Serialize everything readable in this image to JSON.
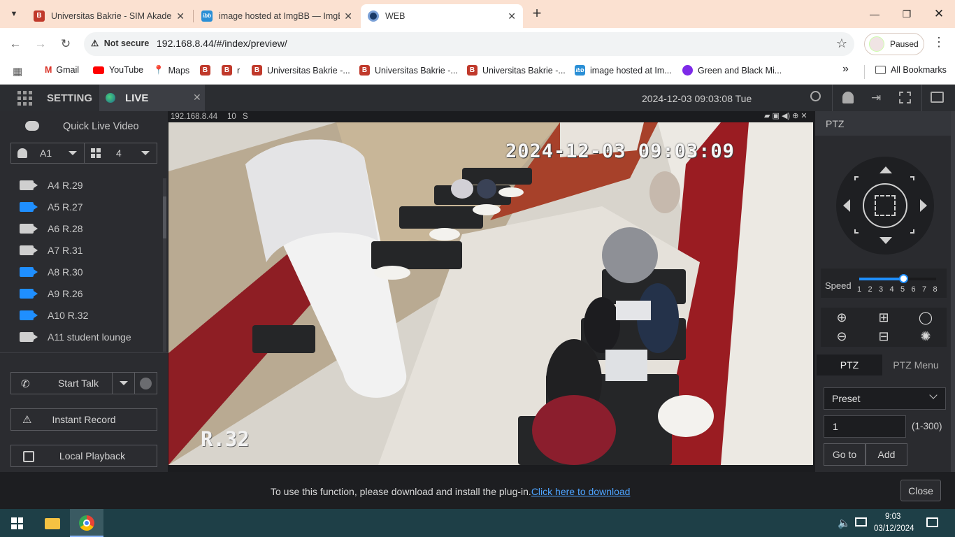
{
  "browser": {
    "tabs": [
      {
        "title": "Universitas Bakrie - SIM Akaden",
        "icon": "ub"
      },
      {
        "title": "image hosted at ImgBB — ImgB",
        "icon": "ibb"
      },
      {
        "title": "WEB",
        "icon": "web"
      }
    ],
    "new_tab": "+",
    "security_label": "Not secure",
    "url": "192.168.8.44/#/index/preview/",
    "profile_status": "Paused",
    "bookmarks": [
      {
        "label": "Gmail",
        "icon": "gmail"
      },
      {
        "label": "YouTube",
        "icon": "youtube"
      },
      {
        "label": "Maps",
        "icon": "maps"
      },
      {
        "label": "",
        "icon": "ub"
      },
      {
        "label": "r",
        "icon": "ub"
      },
      {
        "label": "Universitas Bakrie -...",
        "icon": "ub"
      },
      {
        "label": "Universitas Bakrie -...",
        "icon": "ub"
      },
      {
        "label": "Universitas Bakrie -...",
        "icon": "ub"
      },
      {
        "label": "image hosted at Im...",
        "icon": "ibb"
      },
      {
        "label": "Green and Black Mi...",
        "icon": "canva"
      }
    ],
    "more_bookmarks": "»",
    "all_bookmarks": "All Bookmarks"
  },
  "app": {
    "setting_tab": "SETTING",
    "live_tab": "LIVE",
    "datetime": "2024-12-03 09:03:08 Tue",
    "left": {
      "quick_live": "Quick Live Video",
      "channel_select": "A1",
      "split_select": "4",
      "cameras": [
        {
          "label": "A4 R.29",
          "status": "offline"
        },
        {
          "label": "A5 R.27",
          "status": "online"
        },
        {
          "label": "A6 R.28",
          "status": "offline"
        },
        {
          "label": "A7 R.31",
          "status": "offline"
        },
        {
          "label": "A8 R.30",
          "status": "online"
        },
        {
          "label": "A9 R.26",
          "status": "online"
        },
        {
          "label": "A10 R.32",
          "status": "online"
        },
        {
          "label": "A11 student lounge",
          "status": "offline"
        }
      ],
      "start_talk": "Start Talk",
      "instant_record": "Instant Record",
      "local_playback": "Local Playback"
    },
    "video": {
      "info_ip": "192.168.8.44",
      "info_ch": "10",
      "info_s": "S",
      "osd_time": "2024-12-03 09:03:09",
      "osd_room": "R.32"
    },
    "ptz": {
      "header": "PTZ",
      "speed_label": "Speed",
      "speed_values": [
        "1",
        "2",
        "3",
        "4",
        "5",
        "6",
        "7",
        "8"
      ],
      "speed_current": 5,
      "tab_ptz": "PTZ",
      "tab_menu": "PTZ Menu",
      "preset_select": "Preset",
      "preset_value": "1",
      "preset_range": "(1-300)",
      "goto": "Go to",
      "add": "Add"
    },
    "notice": {
      "text": "To use this function, please download and install the plug-in.",
      "link": "Click here to download",
      "close": "Close"
    }
  },
  "taskbar": {
    "time": "9:03",
    "date": "03/12/2024"
  },
  "colors": {
    "accent_blue": "#1f8fff",
    "tab_strip": "#fbe1d1",
    "app_dark": "#2b2c30"
  }
}
